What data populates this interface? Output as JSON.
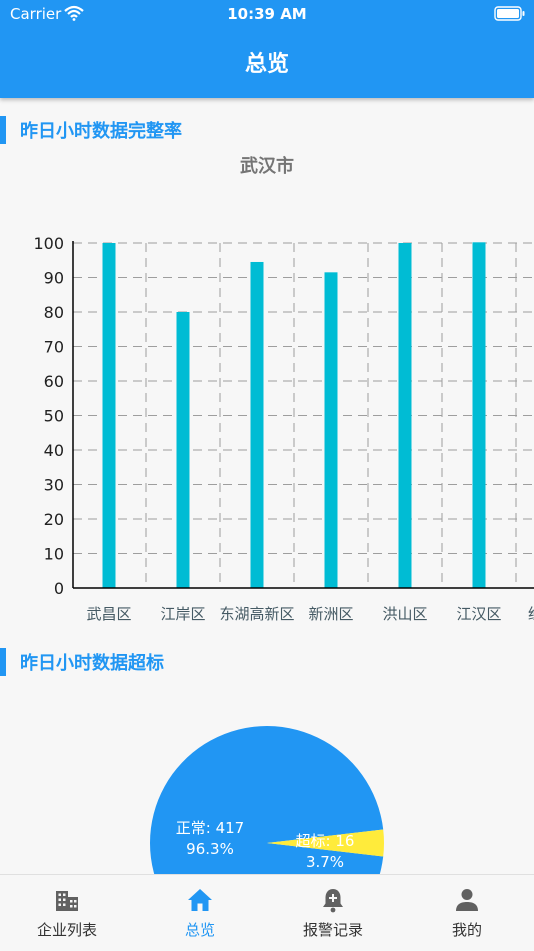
{
  "status_bar": {
    "carrier": "Carrier",
    "time": "10:39 AM"
  },
  "header": {
    "title": "总览"
  },
  "section1": {
    "title": "昨日小时数据完整率"
  },
  "section2": {
    "title": "昨日小时数据超标"
  },
  "chart_data": [
    {
      "type": "bar",
      "title": "武汉市",
      "categories": [
        "武昌区",
        "江岸区",
        "东湖高新区",
        "新洲区",
        "洪山区",
        "江汉区",
        "经济"
      ],
      "values": [
        100,
        80,
        94.5,
        91.5,
        100,
        100.2,
        null
      ],
      "ylim": [
        0,
        100
      ],
      "yticks": [
        0,
        10,
        20,
        30,
        40,
        50,
        60,
        70,
        80,
        90,
        100
      ],
      "grid": true,
      "xlabel": "",
      "ylabel": "",
      "colors": {
        "bar": "#00bcd4",
        "grid": "#9e9e9e",
        "axis": "#000000"
      }
    },
    {
      "type": "pie",
      "slices": [
        {
          "label": "正常: 417",
          "value": 417,
          "percent": "96.3%",
          "color": "#2196f3"
        },
        {
          "label": "超标: 16",
          "value": 16,
          "percent": "3.7%",
          "color": "#ffeb3b"
        }
      ]
    }
  ],
  "tabs": [
    {
      "label": "企业列表",
      "icon": "building-icon",
      "active": false
    },
    {
      "label": "总览",
      "icon": "home-icon",
      "active": true
    },
    {
      "label": "报警记录",
      "icon": "bell-plus-icon",
      "active": false
    },
    {
      "label": "我的",
      "icon": "person-icon",
      "active": false
    }
  ],
  "colors": {
    "primary": "#2196f3",
    "background": "#f7f7f7"
  }
}
